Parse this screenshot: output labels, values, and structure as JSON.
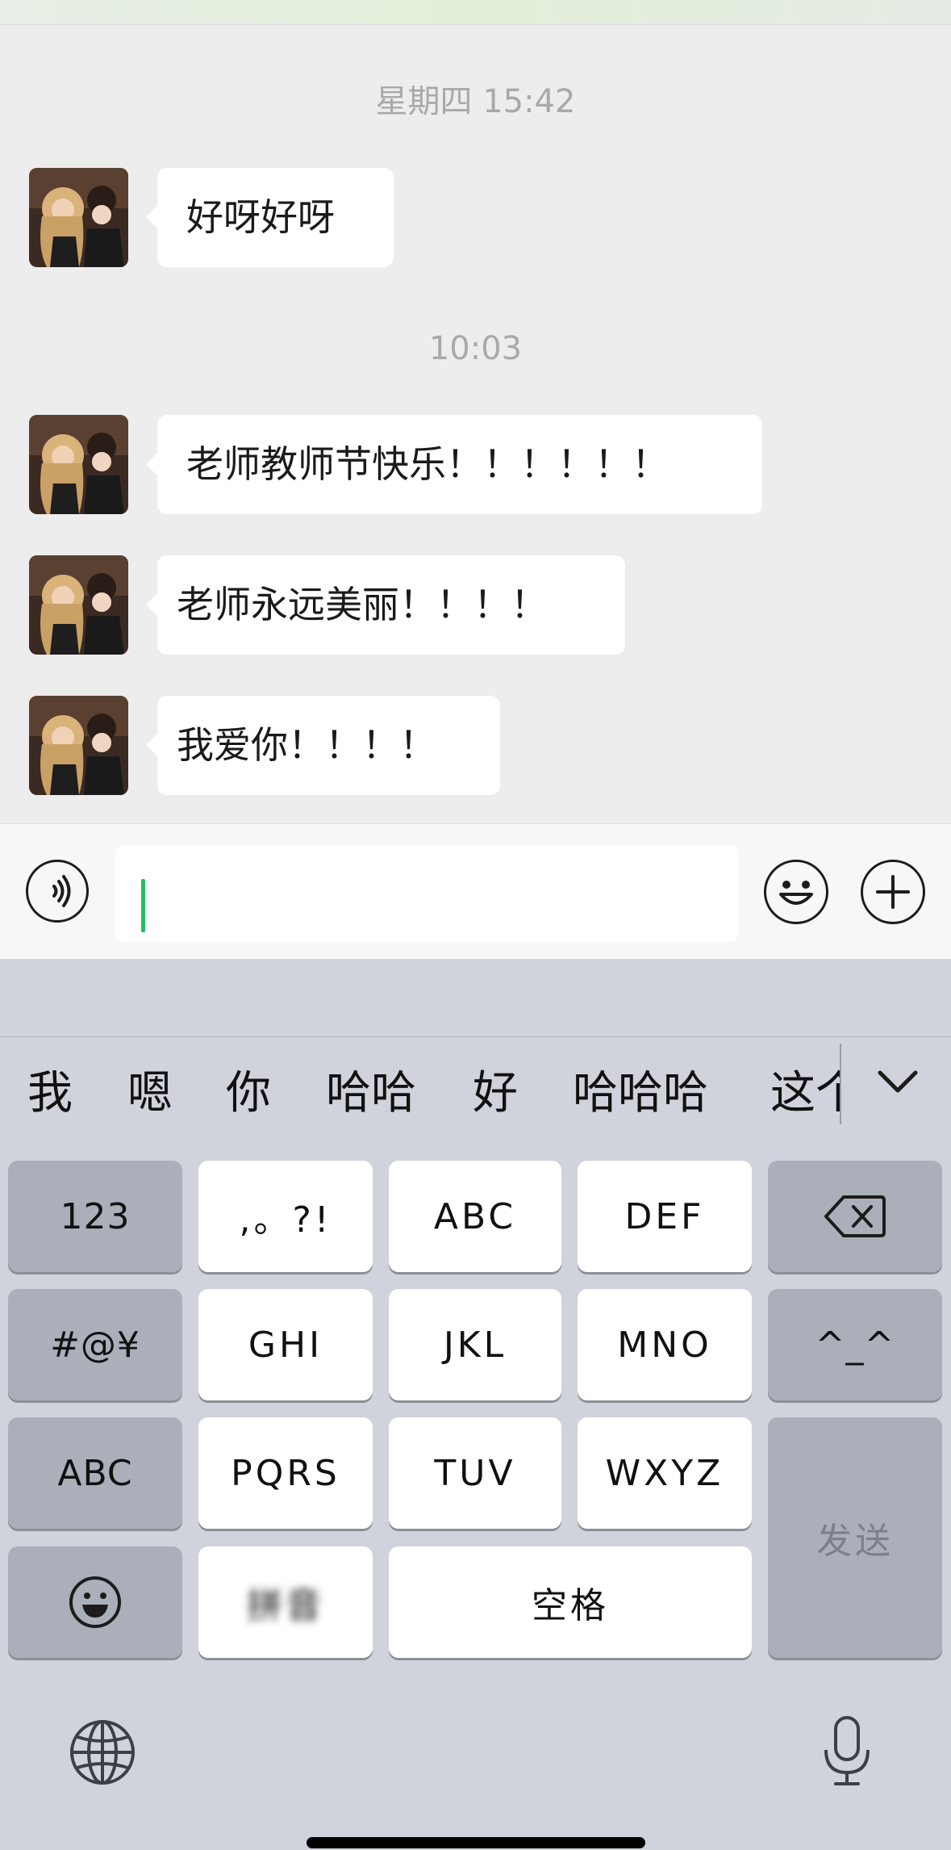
{
  "chat": {
    "timestamps": [
      "星期四 15:42",
      "10:03"
    ],
    "messages": [
      {
        "text": "好呀好呀"
      },
      {
        "text": "老师教师节快乐！！！！！！"
      },
      {
        "text": "老师永远美丽！！！！"
      },
      {
        "text": "我爱你！！！！"
      }
    ]
  },
  "input_bar": {
    "voice_icon": "voice-icon",
    "emoji_icon": "emoji-icon",
    "plus_icon": "plus-icon",
    "caret_color": "#1ec15f"
  },
  "keyboard": {
    "candidates": [
      "我",
      "嗯",
      "你",
      "哈哈",
      "好",
      "哈哈哈",
      "这个"
    ],
    "keys": {
      "num": "123",
      "punct": ",。?!",
      "abc_key": "ABC",
      "def": "DEF",
      "symbols": "#@¥",
      "ghi": "GHI",
      "jkl": "JKL",
      "mno": "MNO",
      "emoticon": "^_^",
      "abc_switch": "ABC",
      "pqrs": "PQRS",
      "tuv": "TUV",
      "wxyz": "WXYZ",
      "send": "发送",
      "pinyin": "拼音",
      "space": "空格"
    },
    "icons": [
      "delete-icon",
      "emoji-key-icon",
      "globe-icon",
      "microphone-icon",
      "chevron-down-icon"
    ]
  }
}
